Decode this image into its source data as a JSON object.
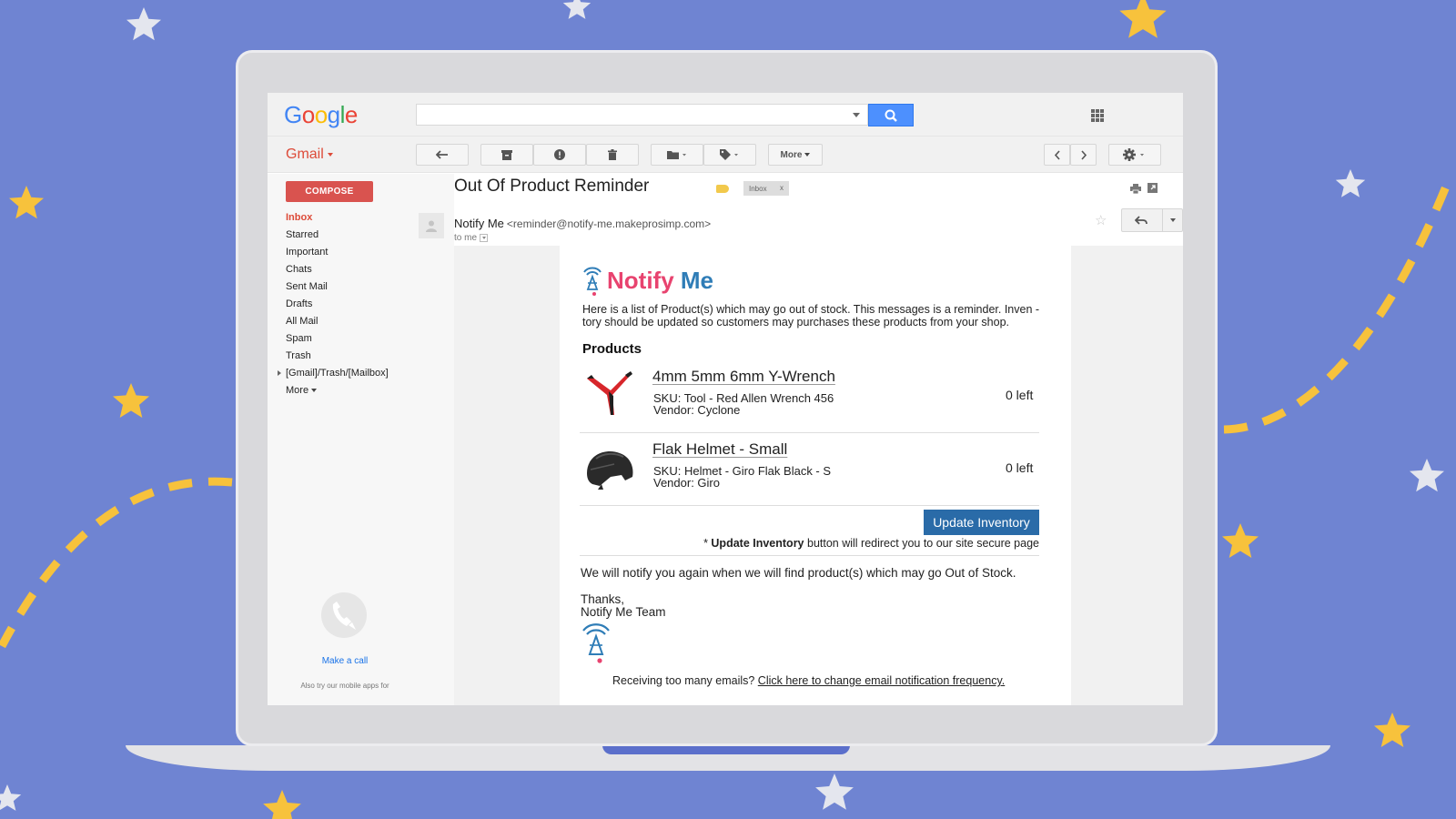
{
  "gmail": {
    "logo": {
      "letters": [
        "G",
        "o",
        "o",
        "g",
        "l",
        "e"
      ],
      "colors": [
        "#4285f4",
        "#ea4335",
        "#fbbc05",
        "#4285f4",
        "#34a853",
        "#ea4335"
      ]
    },
    "search": {
      "placeholder": ""
    },
    "product_label": "Gmail",
    "toolbar": {
      "more_label": "More"
    },
    "compose_label": "COMPOSE",
    "nav": [
      {
        "label": "Inbox",
        "active": true
      },
      {
        "label": "Starred"
      },
      {
        "label": "Important"
      },
      {
        "label": "Chats"
      },
      {
        "label": "Sent Mail"
      },
      {
        "label": "Drafts"
      },
      {
        "label": "All Mail"
      },
      {
        "label": "Spam"
      },
      {
        "label": "Trash"
      },
      {
        "label": "[Gmail]/Trash/[Mailbox]"
      },
      {
        "label": "More"
      }
    ],
    "make_call": "Make a call",
    "also_try": "Also try our mobile apps for"
  },
  "email": {
    "subject": "Out Of Product Reminder",
    "inbox_chip": "Inbox",
    "inbox_chip_close": "x",
    "sender_name": "Notify Me",
    "sender_email": "<reminder@notify-me.makeprosimp.com>",
    "to_me": "to me",
    "body": {
      "brand_part1": "Notify",
      "brand_part2": " Me",
      "intro": "Here is a list of Product(s) which may go out of stock. This messages is a reminder. Inven -tory should be updated so customers may purchases these products from your shop.",
      "products_heading": "Products",
      "products": [
        {
          "title": "4mm 5mm 6mm Y-Wrench",
          "sku": "SKU: Tool - Red Allen Wrench 456",
          "vendor": "Vendor: Cyclone",
          "qty": "0 left"
        },
        {
          "title": "Flak Helmet - Small",
          "sku": "SKU: Helmet - Giro Flak Black - S",
          "vendor": "Vendor: Giro",
          "qty": "0 left"
        }
      ],
      "update_button": "Update Inventory",
      "note_prefix": "* ",
      "note_bold": "Update Inventory",
      "note_rest": " button will redirect you to our site secure page",
      "notify_again": "We will notify you again when we will find product(s) which may go Out of Stock.",
      "thanks_line1": "Thanks,",
      "thanks_line2": "Notify Me Team",
      "unsub_prefix": "Receiving too many emails? ",
      "unsub_link": "Click here to change email notification frequency."
    }
  },
  "colors": {
    "background": "#6f84d2",
    "star_gold": "#f7c23c",
    "star_white": "#e4e6ee",
    "brand_pink": "#e8436f",
    "brand_blue": "#2f7db7",
    "button_blue": "#2a6ba8",
    "gmail_red": "#dd4b39"
  }
}
